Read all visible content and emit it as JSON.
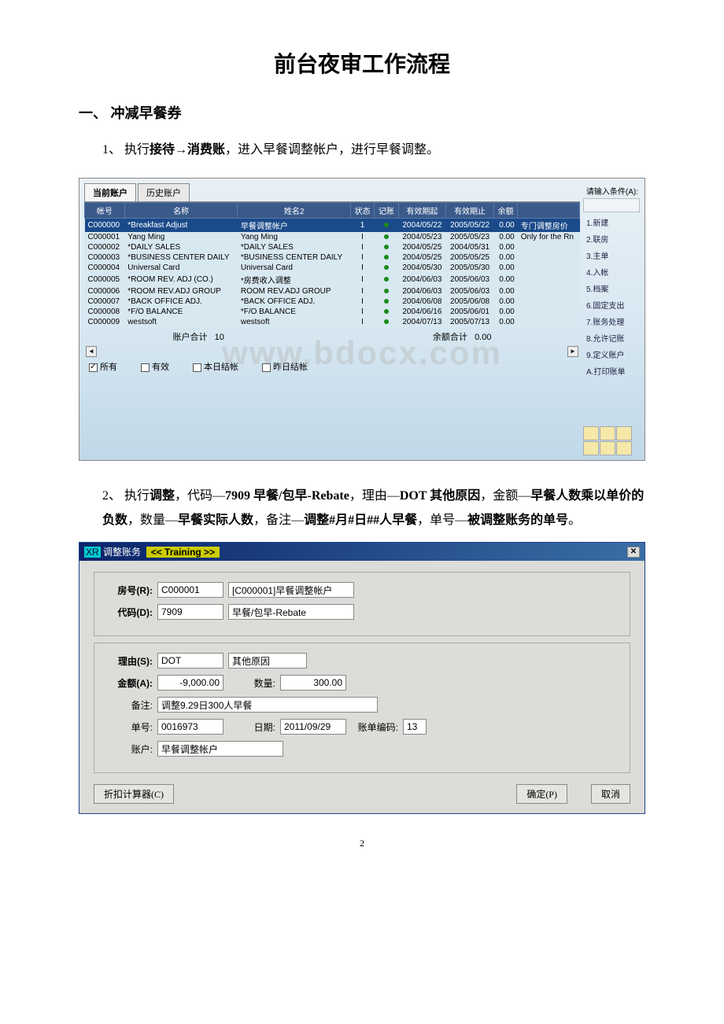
{
  "doc": {
    "title": "前台夜审工作流程",
    "section1": "一、 冲减早餐券",
    "item1_pre": "1、 执行",
    "item1_b1": "接待→消费账",
    "item1_post": "，进入早餐调整帐户，进行早餐调整。",
    "item2_pre": "2、 执行",
    "item2_b1": "调整",
    "item2_t1": "，代码—",
    "item2_b2": "7909 早餐/包早-Rebate",
    "item2_t2": "，理由—",
    "item2_b3": "DOT 其他原因",
    "item2_t3": "，金额—",
    "item2_b4": "早餐人数乘以单价的负数",
    "item2_t4": "，数量—",
    "item2_b5": "早餐实际人数",
    "item2_t5": "，备注—",
    "item2_b6": "调整#月#日##人早餐",
    "item2_t6": "，单号—",
    "item2_b7": "被调整账务的单号",
    "item2_t7": "。",
    "page_number": "2"
  },
  "win1": {
    "tabs": [
      "当前账户",
      "历史账户"
    ],
    "side_label": "请输入条件(A):",
    "headers": [
      "帐号",
      "名称",
      "姓名2",
      "状态",
      "记账",
      "有效期起",
      "有效期止",
      "余额",
      ""
    ],
    "rows": [
      {
        "c0": "C000000",
        "c1": "*Breakfast Adjust",
        "c2": "早餐调整帐户",
        "c3": "1",
        "c4": "●",
        "c5": "2004/05/22",
        "c6": "2005/05/22",
        "c7": "0.00",
        "c8": "专门调整房价",
        "sel": true
      },
      {
        "c0": "C000001",
        "c1": "Yang Ming",
        "c2": "Yang Ming",
        "c3": "I",
        "c4": "●",
        "c5": "2004/05/23",
        "c6": "2005/05/23",
        "c7": "0.00",
        "c8": "Only for the Rn"
      },
      {
        "c0": "C000002",
        "c1": "*DAILY SALES",
        "c2": "*DAILY SALES",
        "c3": "I",
        "c4": "●",
        "c5": "2004/05/25",
        "c6": "2004/05/31",
        "c7": "0.00",
        "c8": ""
      },
      {
        "c0": "C000003",
        "c1": "*BUSINESS CENTER DAILY",
        "c2": "*BUSINESS CENTER DAILY",
        "c3": "I",
        "c4": "●",
        "c5": "2004/05/25",
        "c6": "2005/05/25",
        "c7": "0.00",
        "c8": ""
      },
      {
        "c0": "C000004",
        "c1": "Universal Card",
        "c2": "Universal Card",
        "c3": "I",
        "c4": "●",
        "c5": "2004/05/30",
        "c6": "2005/05/30",
        "c7": "0.00",
        "c8": ""
      },
      {
        "c0": "C000005",
        "c1": "*ROOM REV. ADJ (CO.)",
        "c2": "*房费收入调整",
        "c3": "I",
        "c4": "●",
        "c5": "2004/06/03",
        "c6": "2005/06/03",
        "c7": "0.00",
        "c8": ""
      },
      {
        "c0": "C000006",
        "c1": "*ROOM REV.ADJ GROUP",
        "c2": "ROOM REV.ADJ GROUP",
        "c3": "I",
        "c4": "●",
        "c5": "2004/06/03",
        "c6": "2005/06/03",
        "c7": "0.00",
        "c8": ""
      },
      {
        "c0": "C000007",
        "c1": "*BACK OFFICE ADJ.",
        "c2": "*BACK OFFICE ADJ.",
        "c3": "I",
        "c4": "●",
        "c5": "2004/06/08",
        "c6": "2005/06/08",
        "c7": "0.00",
        "c8": ""
      },
      {
        "c0": "C000008",
        "c1": "*F/O BALANCE",
        "c2": "*F/O BALANCE",
        "c3": "I",
        "c4": "●",
        "c5": "2004/06/16",
        "c6": "2005/06/01",
        "c7": "0.00",
        "c8": ""
      },
      {
        "c0": "C000009",
        "c1": "westsoft",
        "c2": "westsoft",
        "c3": "I",
        "c4": "●",
        "c5": "2004/07/13",
        "c6": "2005/07/13",
        "c7": "0.00",
        "c8": ""
      }
    ],
    "footer": {
      "acct_label": "账户合计",
      "acct_val": "10",
      "amt_label": "余额合计",
      "amt_val": "0.00"
    },
    "checks": {
      "c1": "所有",
      "c2": "有效",
      "c3": "本日结帐",
      "c4": "昨日结帐"
    },
    "sidebtns": [
      "1.新建",
      "2.联房",
      "3.主单",
      "4.入帐",
      "5.档案",
      "6.固定支出",
      "7.账务处理",
      "8.允许记账",
      "9.定义账户",
      "A.打印账单"
    ],
    "watermark": "www.bdocx.com"
  },
  "win2": {
    "title_pre": "调整账务",
    "title_yel": "<< Training >>",
    "labels": {
      "room": "房号(R):",
      "code": "代码(D):",
      "reason": "理由(S):",
      "amount": "金额(A):",
      "qty": "数量:",
      "remark": "备注:",
      "docno": "单号:",
      "date": "日期:",
      "billcode": "账单编码:",
      "acct": "账户:"
    },
    "vals": {
      "room": "C000001",
      "room_desc": "[C000001]早餐调整帐户",
      "code": "7909",
      "code_desc": "早餐/包早-Rebate",
      "reason": "DOT",
      "reason_desc": "其他原因",
      "amount": "-9,000.00",
      "qty": "300.00",
      "remark": "调整9.29日300人早餐",
      "docno": "0016973",
      "date": "2011/09/29",
      "billcode": "13",
      "acct": "早餐调整帐户"
    },
    "buttons": {
      "calc": "折扣计算器(C)",
      "ok": "确定(P)",
      "cancel": "取消"
    }
  }
}
